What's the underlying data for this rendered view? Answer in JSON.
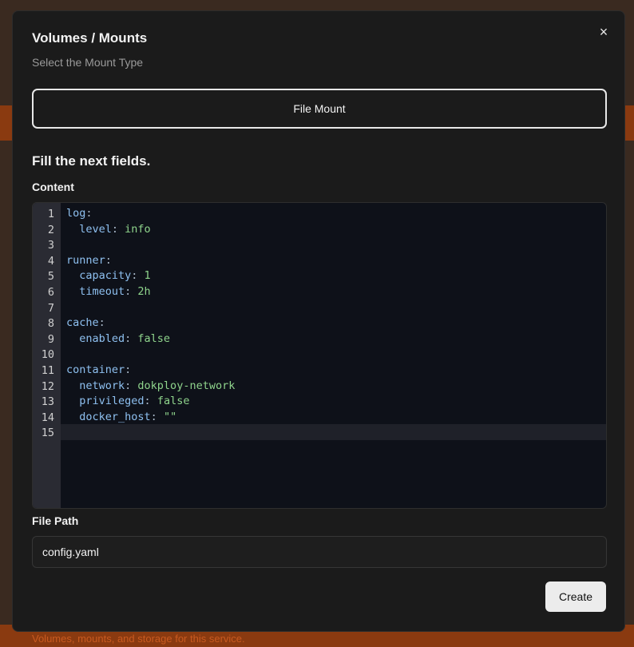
{
  "dialog": {
    "title": "Volumes / Mounts",
    "subtitle": "Select the Mount Type",
    "close_icon": "×",
    "mount_type_label": "File Mount",
    "section_title": "Fill the next fields.",
    "content_label": "Content",
    "file_path_label": "File Path",
    "file_path_value": "config.yaml",
    "create_label": "Create"
  },
  "editor": {
    "lines": [
      [
        {
          "t": "log",
          "c": "k"
        },
        {
          "t": ":",
          "c": "p"
        }
      ],
      [
        {
          "t": "  level",
          "c": "k"
        },
        {
          "t": ": ",
          "c": "p"
        },
        {
          "t": "info",
          "c": "v"
        }
      ],
      [],
      [
        {
          "t": "runner",
          "c": "k"
        },
        {
          "t": ":",
          "c": "p"
        }
      ],
      [
        {
          "t": "  capacity",
          "c": "k"
        },
        {
          "t": ": ",
          "c": "p"
        },
        {
          "t": "1",
          "c": "v"
        }
      ],
      [
        {
          "t": "  timeout",
          "c": "k"
        },
        {
          "t": ": ",
          "c": "p"
        },
        {
          "t": "2h",
          "c": "v"
        }
      ],
      [],
      [
        {
          "t": "cache",
          "c": "k"
        },
        {
          "t": ":",
          "c": "p"
        }
      ],
      [
        {
          "t": "  enabled",
          "c": "k"
        },
        {
          "t": ": ",
          "c": "p"
        },
        {
          "t": "false",
          "c": "v"
        }
      ],
      [],
      [
        {
          "t": "container",
          "c": "k"
        },
        {
          "t": ":",
          "c": "p"
        }
      ],
      [
        {
          "t": "  network",
          "c": "k"
        },
        {
          "t": ": ",
          "c": "p"
        },
        {
          "t": "dokploy-network",
          "c": "v"
        }
      ],
      [
        {
          "t": "  privileged",
          "c": "k"
        },
        {
          "t": ": ",
          "c": "p"
        },
        {
          "t": "false",
          "c": "v"
        }
      ],
      [
        {
          "t": "  docker_host",
          "c": "k"
        },
        {
          "t": ": ",
          "c": "p"
        },
        {
          "t": "\"\"",
          "c": "v"
        }
      ],
      []
    ],
    "active_line": 15
  },
  "background": {
    "footer_text": "Volumes, mounts, and storage for this service."
  },
  "colors": {
    "dialog_bg": "#1b1b1b",
    "editor_bg": "#0e1119",
    "key": "#8ec0f0",
    "value": "#8fd48c",
    "backdrop_accent": "#8a3a10"
  }
}
